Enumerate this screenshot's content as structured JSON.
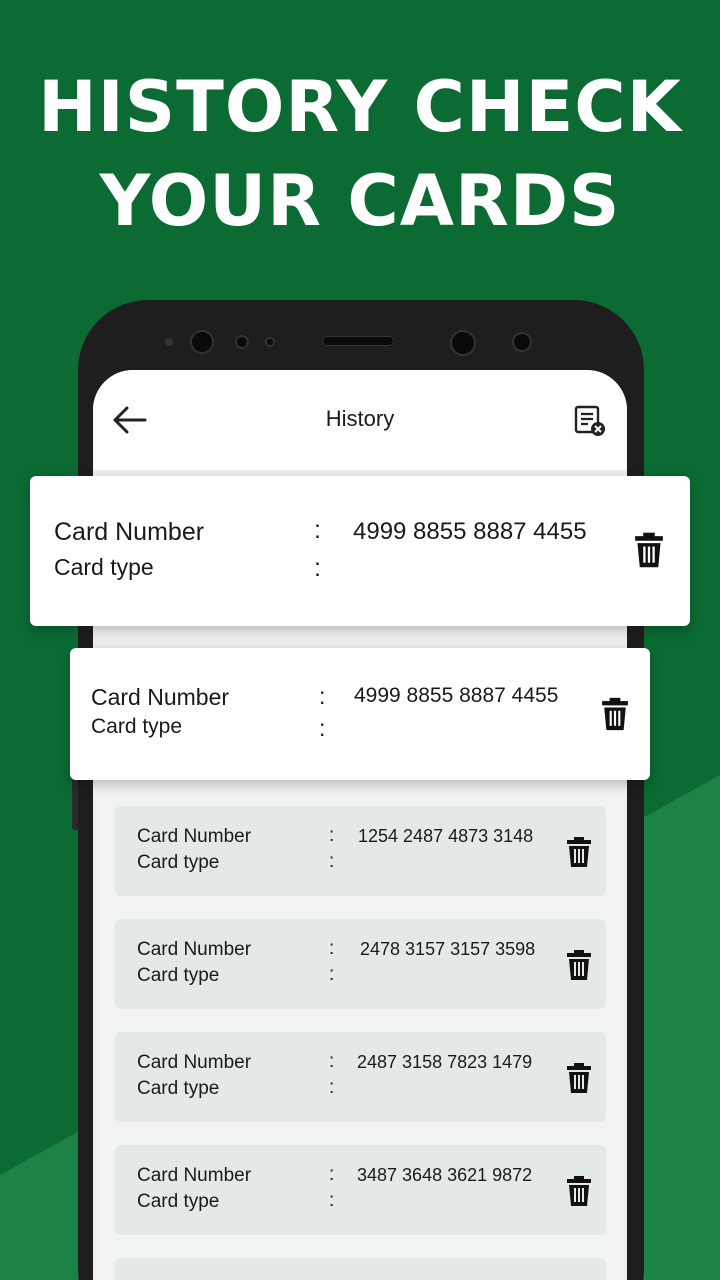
{
  "headline": {
    "line1": "HISTORY CHECK",
    "line2": "YOUR CARDS"
  },
  "colors": {
    "background": "#0b6b33",
    "row_background": "#e3e9e6",
    "text": "#1a1a1a"
  },
  "appbar": {
    "title": "History",
    "back_icon": "arrow-left-icon",
    "clear_icon": "clear-history-icon"
  },
  "labels": {
    "card_number": "Card Number",
    "card_type": "Card type",
    "colon": ":"
  },
  "featured_cards": [
    {
      "card_number": "4999 8855 8887 4455",
      "card_type": ""
    },
    {
      "card_number": "4999 8855 8887 4455",
      "card_type": ""
    }
  ],
  "history": [
    {
      "card_number": "1254 2487 4873 3148",
      "card_type": ""
    },
    {
      "card_number": "2478 3157 3157 3598",
      "card_type": ""
    },
    {
      "card_number": "2487 3158 7823 1479",
      "card_type": ""
    },
    {
      "card_number": "3487 3648 3621 9872",
      "card_type": ""
    }
  ]
}
